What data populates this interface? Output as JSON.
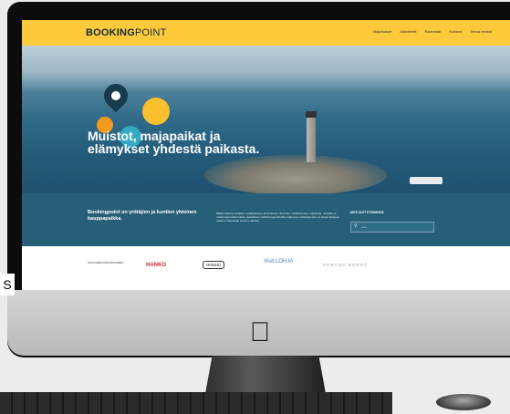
{
  "header": {
    "logo_bold": "BOOKING",
    "logo_rest": "POINT",
    "nav": [
      "Majoitukset",
      "Aktiviteetit",
      "Ravintolat",
      "Kohteet",
      "Tietoa meistä"
    ]
  },
  "hero": {
    "headline": "Muistot, majapaikat ja elämykset yhdestä paikasta."
  },
  "band": {
    "tagline": "Bookingpoint on yrittäjien ja kuntien yhteinen kauppapaikka.",
    "description": "Mikäli haluat ja tiedoksi varattavissa ja toimintoissa. Bed iden mahteinumsa, majoitusta, ruusulla ne matkustaja kokemuksia, paikallisten valloittavupuutinuitten hakemus verkkokaupan ne tietoja tietoja ja vaiheen hakuohjaa kunkin paikasta.",
    "search_label": "MITÄ OLET ETSIMÄSSÄ",
    "search_placeholder": "Hae..."
  },
  "partners": [
    "SIPOOWEN PROGRAMMES",
    "HANKO",
    "Helsinki",
    "Visit LOHJA",
    "PORVOO BORGÅ"
  ],
  "side_letter": "S",
  "colors": {
    "header": "#ffc93c",
    "band": "#285f78",
    "accent_teal": "#35a9c2",
    "accent_orange": "#f39a1f"
  }
}
